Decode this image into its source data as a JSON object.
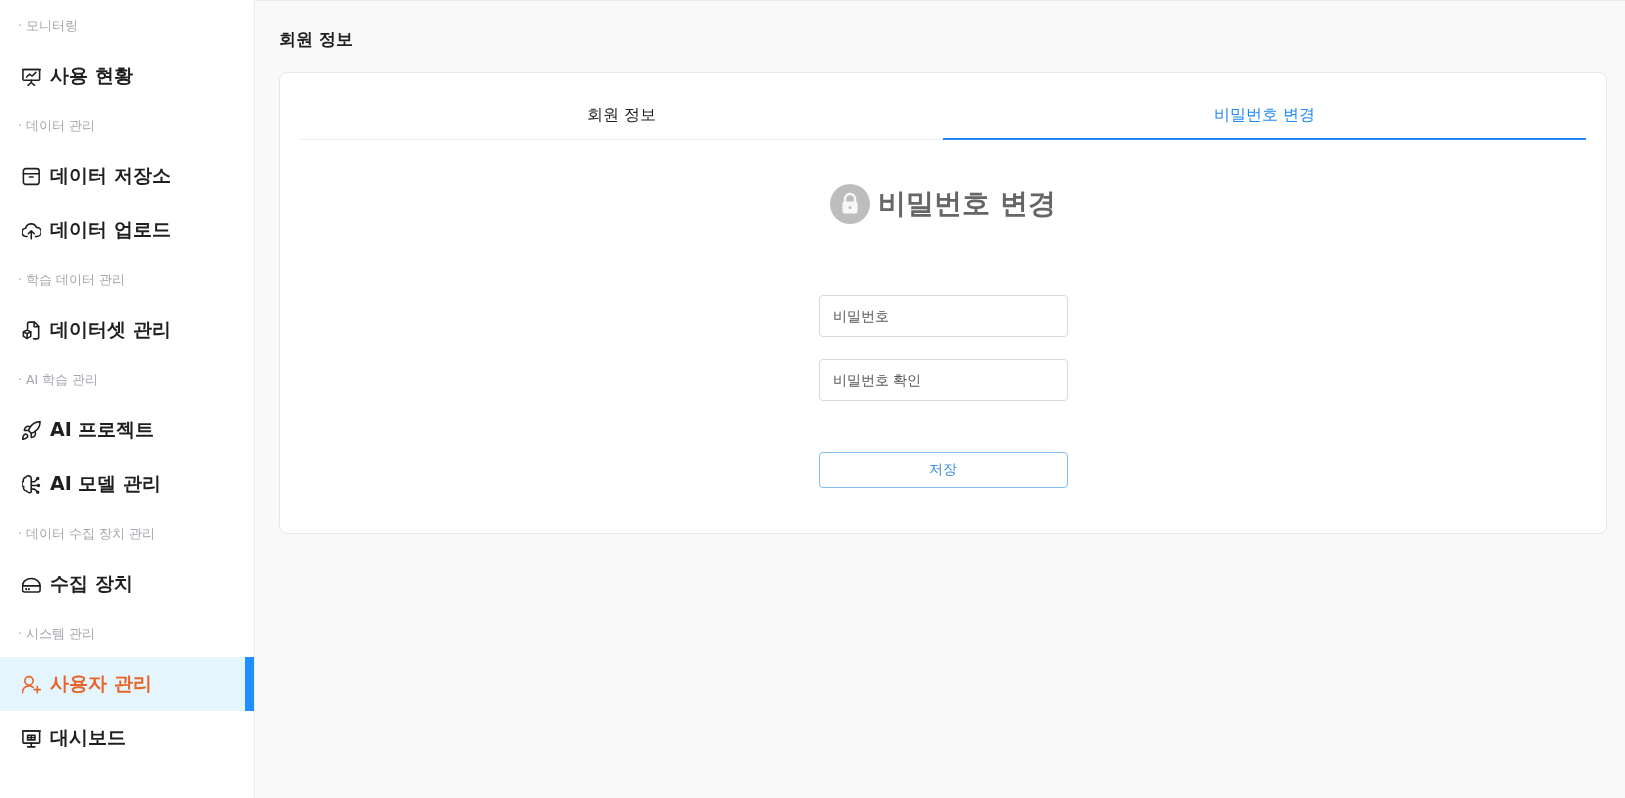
{
  "sidebar": {
    "sections": [
      {
        "label": "· 모니터링",
        "items": [
          {
            "label": "사용 현황",
            "selected": false
          }
        ]
      },
      {
        "label": "· 데이터 관리",
        "items": [
          {
            "label": "데이터 저장소",
            "selected": false
          },
          {
            "label": "데이터 업로드",
            "selected": false
          }
        ]
      },
      {
        "label": "· 학습 데이터 관리",
        "items": [
          {
            "label": "데이터셋 관리",
            "selected": false
          }
        ]
      },
      {
        "label": "· AI 학습 관리",
        "items": [
          {
            "label": "AI 프로젝트",
            "selected": false
          },
          {
            "label": "AI 모델 관리",
            "selected": false
          }
        ]
      },
      {
        "label": "· 데이터 수집 장치 관리",
        "items": [
          {
            "label": "수집 장치",
            "selected": false
          }
        ]
      },
      {
        "label": "· 시스템 관리",
        "items": [
          {
            "label": "사용자 관리",
            "selected": true
          },
          {
            "label": "대시보드",
            "selected": false
          }
        ]
      }
    ]
  },
  "page_title": "회원 정보",
  "card": {
    "tabs": [
      {
        "label": "회원 정보",
        "selected": false
      },
      {
        "label": "비밀번호 변경",
        "selected": true
      }
    ],
    "heading": "비밀번호 변경",
    "fields": [
      {
        "placeholder": "비밀번호"
      },
      {
        "placeholder": "비밀번호 확인"
      }
    ],
    "button": "저장"
  }
}
